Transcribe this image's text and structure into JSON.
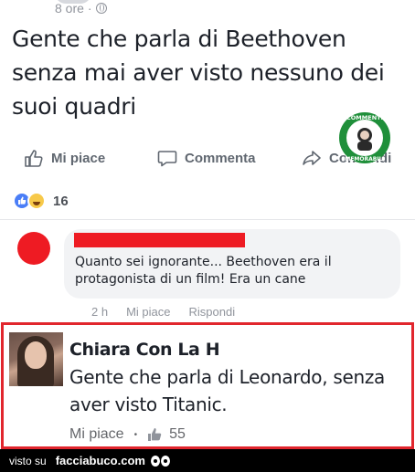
{
  "post": {
    "time": "8 ore",
    "text": "Gente che parla di Beethoven senza mai aver visto nessuno dei suoi quadri",
    "actions": {
      "like_label": "Mi piace",
      "comment_label": "Commenta",
      "share_label": "Condividi"
    },
    "reactions_count": "16"
  },
  "watermark": {
    "text_top": "COMMENTI",
    "text_bottom": "MEMORABILI"
  },
  "comment": {
    "text": "Quanto sei ignorante... Beethoven era il protagonista di un film! Era un cane",
    "time": "2 h",
    "like_label": "Mi piace",
    "reply_label": "Rispondi",
    "avatar_color": "#ee1b23"
  },
  "reply": {
    "name": "Chiara Con La H",
    "text": "Gente che parla di Leonardo, senza aver visto Titanic.",
    "like_label": "Mi piace",
    "likes_count": "55",
    "highlight_color": "#e1262d"
  },
  "footer": {
    "prefix": "visto su",
    "brand": "facciabuco.com"
  }
}
